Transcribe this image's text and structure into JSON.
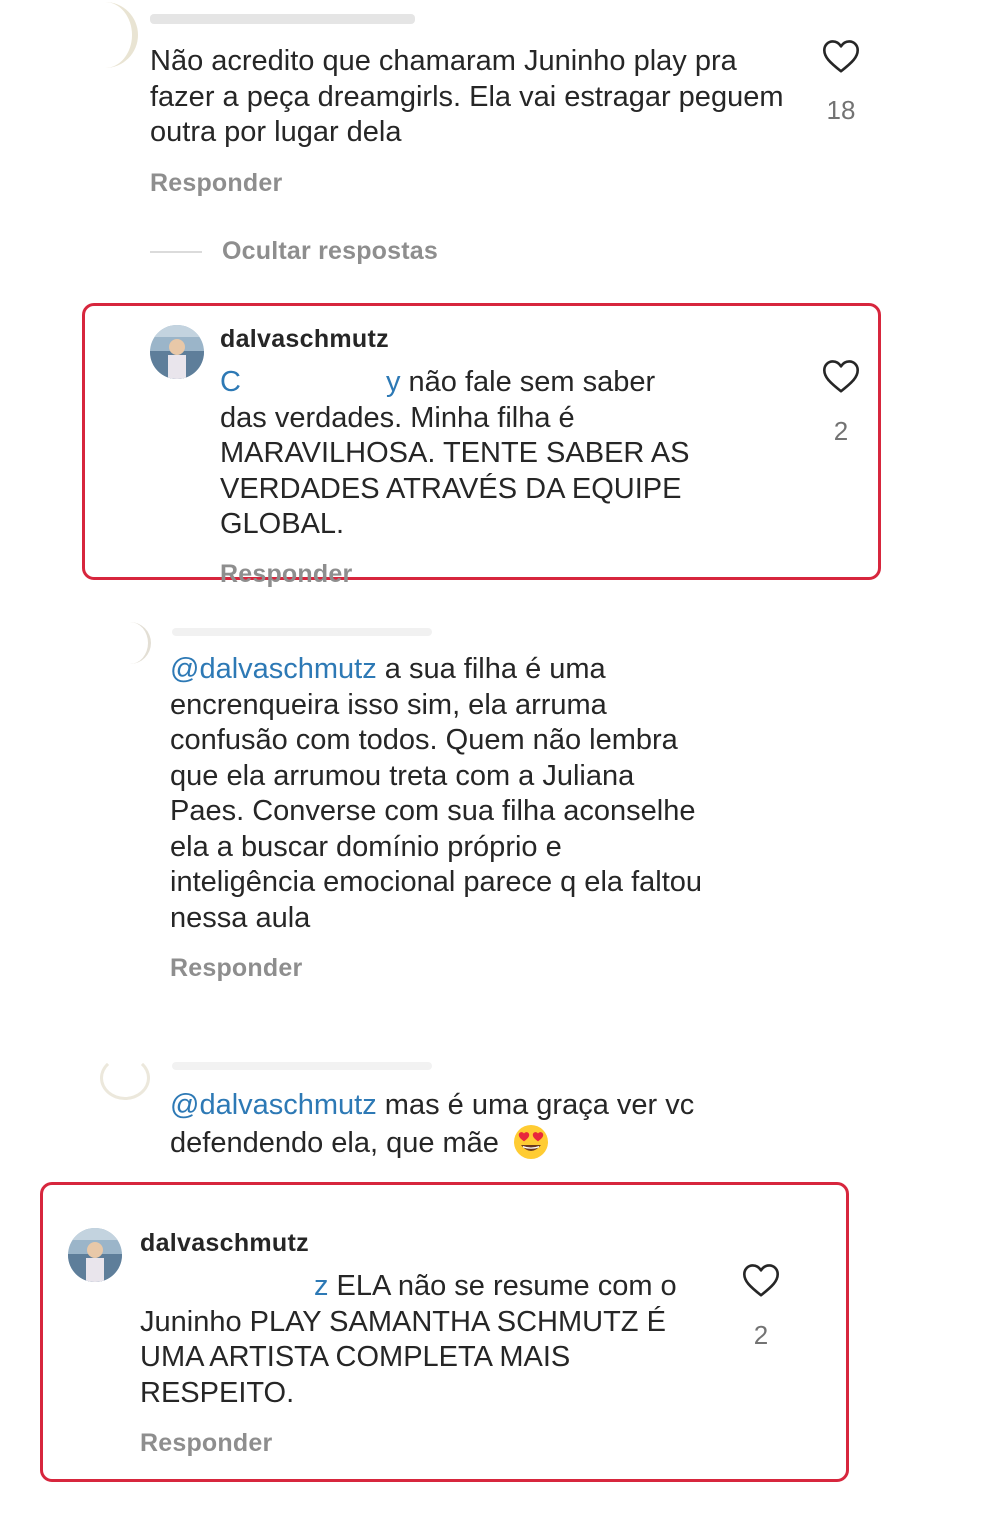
{
  "comments": [
    {
      "text": "Não acredito que chamaram Juninho play pra fazer a peça dreamgirls. Ela vai estragar peguem outra por lugar dela",
      "likes": "18",
      "reply_label": "Responder"
    }
  ],
  "hide_replies_label": "Ocultar respostas",
  "replies": [
    {
      "username": "dalvaschmutz",
      "mention_fragment_a": "C",
      "mention_fragment_b": "y",
      "text_line1": " não fale sem saber",
      "text_rest": "das verdades. Minha filha é MARAVILHOSA. TENTE SABER AS VERDADES ATRAVÉS DA EQUIPE GLOBAL.",
      "likes": "2",
      "reply_label": "Responder"
    },
    {
      "mention": "@dalvaschmutz",
      "text": " a sua filha é uma encrenqueira isso sim, ela arruma confusão com todos. Quem não lembra que ela arrumou treta com a Juliana Paes. Converse com sua filha aconselhe ela a buscar domínio próprio e inteligência emocional parece q ela faltou nessa aula",
      "reply_label": "Responder"
    },
    {
      "mention": "@dalvaschmutz",
      "text": " mas é uma graça ver vc defendendo ela, que mãe",
      "emoji": "heart-eyes-emoji"
    },
    {
      "username": "dalvaschmutz",
      "mention_fragment": "z",
      "text": " ELA não se resume com o Juninho PLAY SAMANTHA SCHMUTZ É UMA ARTISTA COMPLETA MAIS RESPEITO.",
      "likes": "2",
      "reply_label": "Responder"
    }
  ],
  "icons": {
    "like": "heart-outline-icon"
  },
  "colors": {
    "highlight_border": "#d7263d",
    "mention": "#2d79b5",
    "secondary_text": "#8e8e8e"
  }
}
